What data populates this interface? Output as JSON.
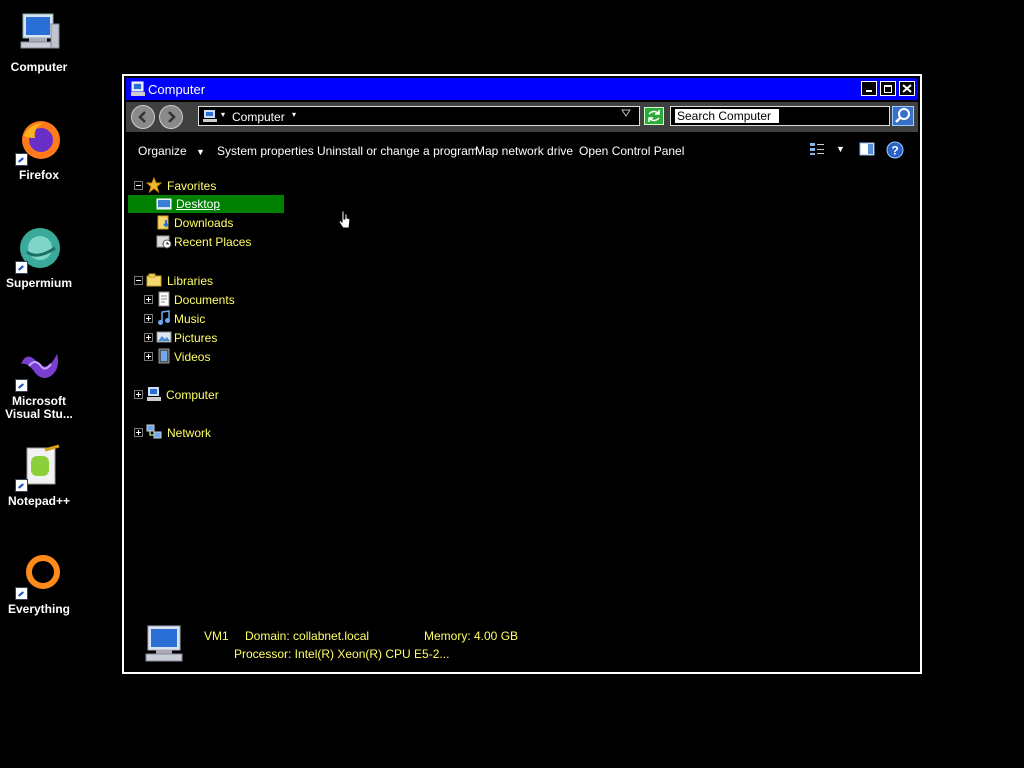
{
  "desktop": {
    "icons": [
      {
        "label": "Computer",
        "icon": "computer-icon"
      },
      {
        "label": "Firefox",
        "icon": "firefox-icon"
      },
      {
        "label": "Supermium",
        "icon": "supermium-icon"
      },
      {
        "label_line1": "Microsoft",
        "label_line2": "Visual Stu...",
        "icon": "visual-studio-icon"
      },
      {
        "label": "Notepad++",
        "icon": "notepad-plus-plus-icon"
      },
      {
        "label": "Everything",
        "icon": "everything-icon"
      }
    ]
  },
  "window": {
    "title": "Computer",
    "address": {
      "location": "Computer",
      "dropdown_glyph": "▾"
    },
    "search": {
      "value": "Search Computer"
    },
    "toolbar": {
      "organize": "Organize",
      "system_properties": "System properties",
      "uninstall": "Uninstall or change a program",
      "map_drive": "Map network drive",
      "control_panel": "Open Control Panel"
    },
    "nav": {
      "favorites": "Favorites",
      "desktop": "Desktop",
      "downloads": "Downloads",
      "recent_places": "Recent Places",
      "libraries": "Libraries",
      "documents": "Documents",
      "music": "Music",
      "pictures": "Pictures",
      "videos": "Videos",
      "computer": "Computer",
      "network": "Network"
    },
    "details": {
      "name": "VM1",
      "domain": "Domain: collabnet.local",
      "memory": "Memory: 4.00 GB",
      "processor": "Processor: Intel(R) Xeon(R) CPU E5-2..."
    }
  },
  "colors": {
    "title_bar": "#0000ff",
    "tree_text": "#ffff66",
    "selection": "#008000",
    "background": "#000000"
  }
}
